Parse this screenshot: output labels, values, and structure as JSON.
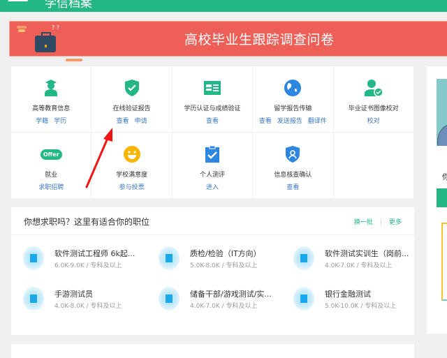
{
  "header": {
    "title": "学信档案"
  },
  "banner": {
    "title": "高校毕业生跟踪调查问卷"
  },
  "services": [
    {
      "name": "高等教育信息",
      "links": [
        "学籍",
        "学历"
      ],
      "icon": "graduate-icon"
    },
    {
      "name": "在线验证报告",
      "links": [
        "查看",
        "申请"
      ],
      "icon": "shield-check-icon"
    },
    {
      "name": "学历认证与成绩验证",
      "links": [
        "查看"
      ],
      "icon": "id-card-icon"
    },
    {
      "name": "留学报告传输",
      "links": [
        "查看",
        "发送报告",
        "翻译件"
      ],
      "icon": "globe-icon"
    },
    {
      "name": "毕业证书图像校对",
      "links": [
        "校对"
      ],
      "icon": "user-check-icon"
    },
    {
      "name": "就业",
      "links": [
        "求职招聘"
      ],
      "icon": "offer-icon",
      "icon_text": "Offer"
    },
    {
      "name": "学校满意度",
      "links": [
        "参与投票"
      ],
      "icon": "smiley-icon"
    },
    {
      "name": "个人测评",
      "links": [
        "进入"
      ],
      "icon": "clipboard-check-icon"
    },
    {
      "name": "信息核查确认",
      "links": [
        "查看"
      ],
      "icon": "shield-user-icon"
    }
  ],
  "jobs": {
    "title": "你想求职吗？这里有适合你的职位",
    "refresh": "换一批",
    "more": "更多",
    "sep": "|",
    "items": [
      {
        "title": "软件测试工程师 6k起...",
        "salary": "6.0K-9.0K",
        "edu": "专科及以上"
      },
      {
        "title": "质检/检验（IT方向）",
        "salary": "5.0K-8.0K",
        "edu": "专科及以上"
      },
      {
        "title": "软件测试实训生（岗前...",
        "salary": "4.0K-7.0K",
        "edu": "专科及以上"
      },
      {
        "title": "手游测试员",
        "salary": "4.0K-8.0K",
        "edu": "专科及以上"
      },
      {
        "title": "储备干部/游戏测试/实...",
        "salary": "4.0K-7.0K",
        "edu": "专科及以上"
      },
      {
        "title": "银行金融测试",
        "salary": "5.0K-10.0K",
        "edu": "专科及以上"
      }
    ],
    "slash": "/"
  },
  "side": {
    "text": "你"
  },
  "colors": {
    "green": "#22b784",
    "red": "#ee5f57",
    "blue": "#3a7ac8"
  }
}
